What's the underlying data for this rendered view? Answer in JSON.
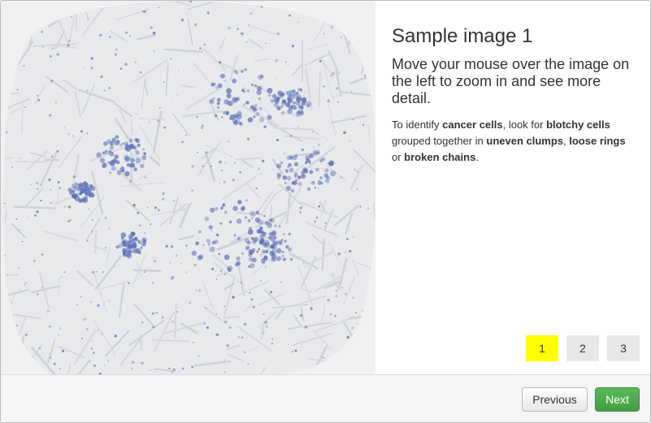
{
  "sample": {
    "title": "Sample image 1",
    "instruction": "Move your mouse over the image on the left to zoom in and see more detail.",
    "hint": [
      {
        "text": "To identify ",
        "bold": false
      },
      {
        "text": "cancer cells",
        "bold": true
      },
      {
        "text": ", look for ",
        "bold": false
      },
      {
        "text": "blotchy cells",
        "bold": true
      },
      {
        "text": " grouped together in ",
        "bold": false
      },
      {
        "text": "uneven clumps",
        "bold": true
      },
      {
        "text": ", ",
        "bold": false
      },
      {
        "text": "loose rings",
        "bold": true
      },
      {
        "text": " or ",
        "bold": false
      },
      {
        "text": "broken chains",
        "bold": true
      },
      {
        "text": ".",
        "bold": false
      }
    ]
  },
  "pager": {
    "pages": [
      "1",
      "2",
      "3"
    ],
    "active_index": 0,
    "active_color": "#ffff00"
  },
  "footer": {
    "previous_label": "Previous",
    "next_label": "Next"
  },
  "colors": {
    "tissue_background": "#f1f1f1",
    "stain_blue": "#5a6db8",
    "stain_gray": "#6f6f6f",
    "next_button": "#5cb85c"
  }
}
